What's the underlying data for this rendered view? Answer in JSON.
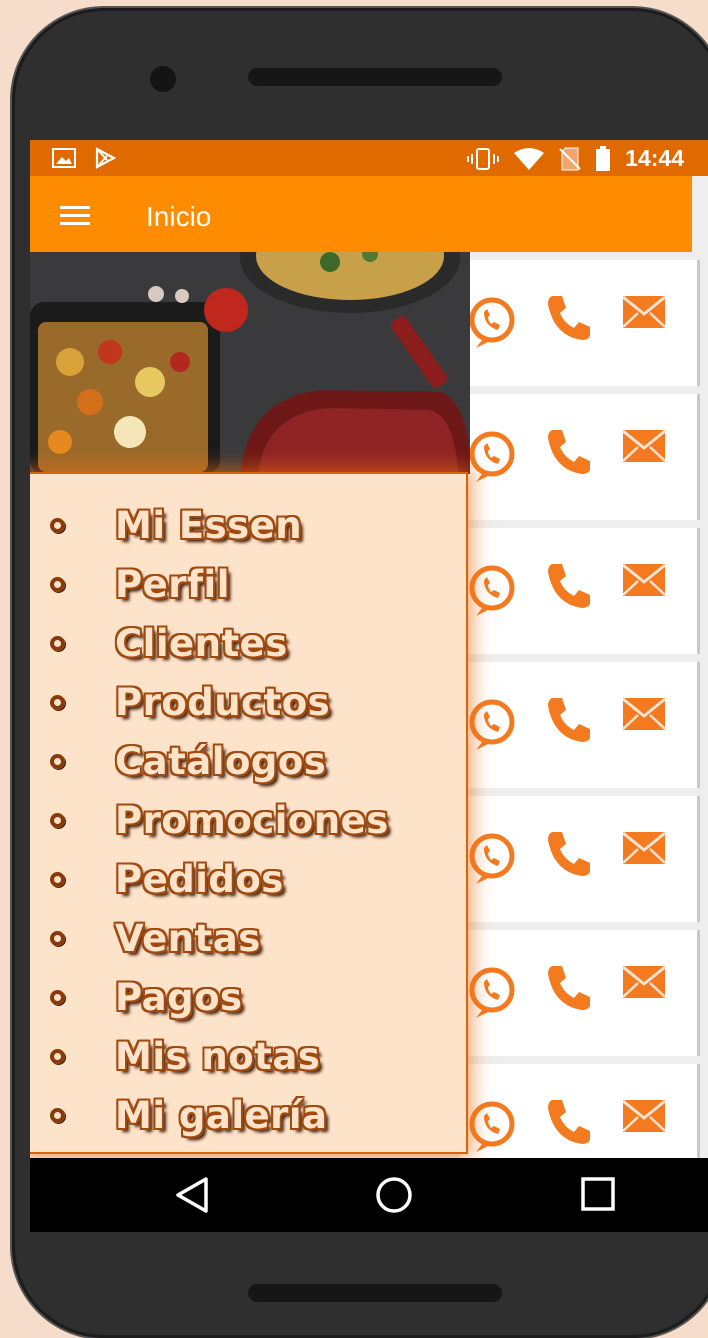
{
  "status_bar": {
    "time": "14:44",
    "left_icons": [
      "image-icon",
      "play-store-icon"
    ],
    "right_icons": [
      "vibrate-icon",
      "wifi-icon",
      "no-sim-icon",
      "battery-icon"
    ]
  },
  "app_bar": {
    "menu_icon": "hamburger-menu-icon",
    "title": "Inicio"
  },
  "drawer": {
    "items": [
      {
        "label": "Mi Essen"
      },
      {
        "label": "Perfil"
      },
      {
        "label": "Clientes"
      },
      {
        "label": "Productos"
      },
      {
        "label": "Catálogos"
      },
      {
        "label": "Promociones"
      },
      {
        "label": "Pedidos"
      },
      {
        "label": "Ventas"
      },
      {
        "label": "Pagos"
      },
      {
        "label": "Mis notas"
      },
      {
        "label": "Mi galería"
      }
    ]
  },
  "contact_rows": {
    "row_count": 7,
    "icons": [
      "whatsapp-icon",
      "phone-icon",
      "mail-icon"
    ],
    "accent_color": "#f47a20"
  },
  "nav_bar": {
    "buttons": [
      "back-icon",
      "home-icon",
      "recents-icon"
    ]
  },
  "colors": {
    "status_bar": "#e06a00",
    "app_bar": "#ff8c00",
    "drawer_background": "#fee3cb",
    "menu_text_outline": "#a04a10"
  }
}
